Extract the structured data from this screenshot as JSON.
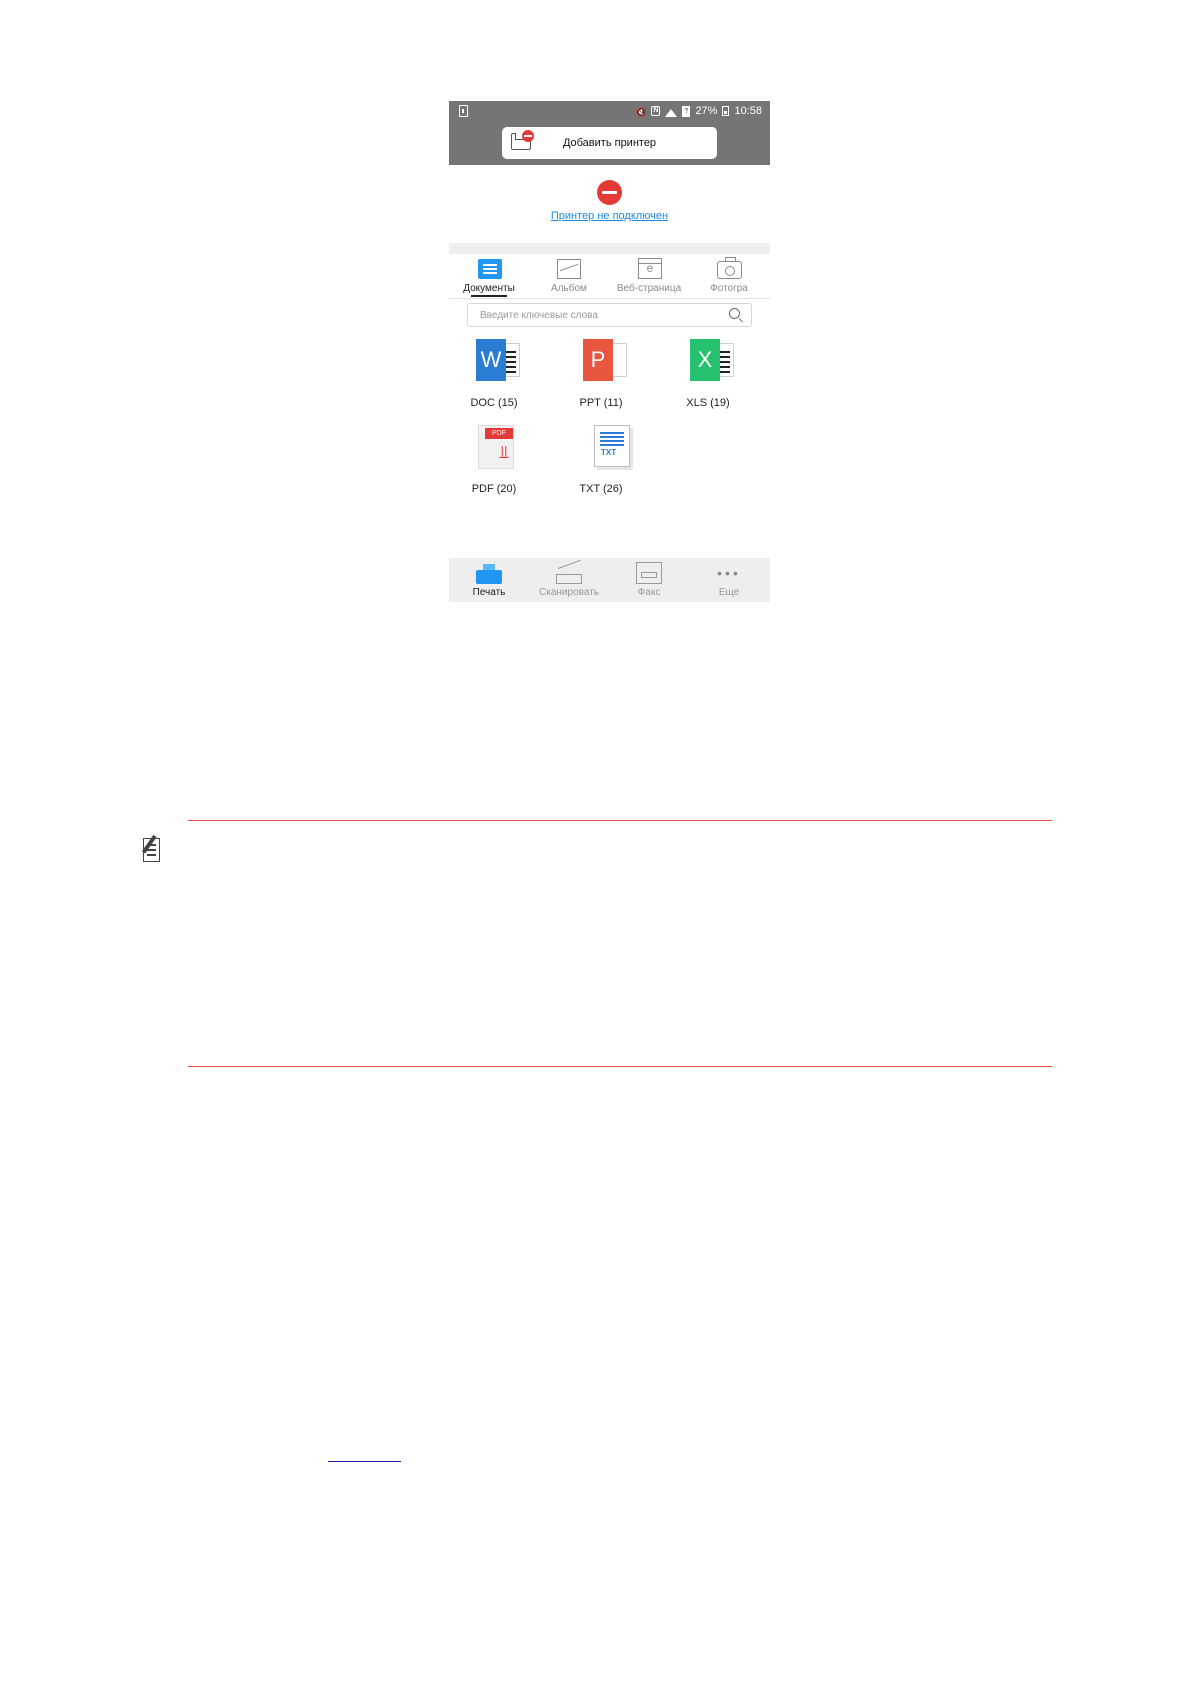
{
  "status_bar": {
    "battery": "27%",
    "time": "10:58"
  },
  "header": {
    "add_printer_label": "Добавить принтер"
  },
  "printer_status": {
    "text": "Принтер не подключен"
  },
  "tabs": [
    {
      "label": "Документы",
      "icon": "document-icon",
      "active": true
    },
    {
      "label": "Альбом",
      "icon": "image-icon",
      "active": false
    },
    {
      "label": "Веб-страница",
      "icon": "web-page-icon",
      "active": false
    },
    {
      "label": "Фотогра",
      "icon": "camera-icon",
      "active": false
    }
  ],
  "search": {
    "placeholder": "Введите ключевые слова"
  },
  "files": [
    {
      "label": "DOC (15)",
      "icon": "word-doc-icon"
    },
    {
      "label": "PPT (11)",
      "icon": "powerpoint-icon"
    },
    {
      "label": "XLS (19)",
      "icon": "excel-icon"
    },
    {
      "label": "PDF (20)",
      "icon": "pdf-icon"
    },
    {
      "label": "TXT (26)",
      "icon": "txt-icon"
    }
  ],
  "file_icon_letters": {
    "doc": "W",
    "ppt": "P",
    "xls": "X",
    "pdf_tag": "PDF",
    "txt_tag": "TXT"
  },
  "bottom_nav": [
    {
      "label": "Печать",
      "icon": "print-icon",
      "active": true
    },
    {
      "label": "Сканировать",
      "icon": "scan-icon",
      "active": false
    },
    {
      "label": "Факс",
      "icon": "fax-icon",
      "active": false
    },
    {
      "label": "Еще",
      "icon": "more-icon",
      "active": false
    }
  ],
  "colors": {
    "accent_blue": "#2196f3",
    "error_red": "#e53935",
    "rule_red": "#e74c3c",
    "top_bar_gray": "#757575"
  }
}
